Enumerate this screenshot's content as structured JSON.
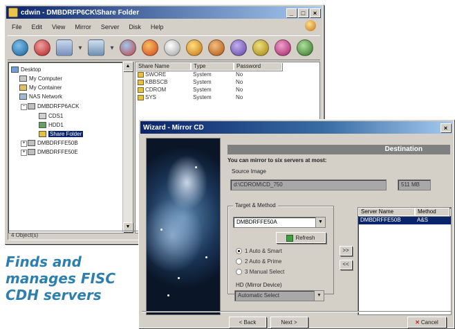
{
  "explorer": {
    "title": "cdwin - DMBDRFP6CK\\Share Folder",
    "menu": [
      "File",
      "Edit",
      "View",
      "Mirror",
      "Server",
      "Disk",
      "Help"
    ],
    "status": "4 Object(s)",
    "tree": [
      {
        "label": "Desktop",
        "level": 0
      },
      {
        "label": "My Computer",
        "level": 1
      },
      {
        "label": "My Container",
        "level": 1
      },
      {
        "label": "NAS Network",
        "level": 1
      },
      {
        "label": "DMBDRFP6ACK",
        "level": 2
      },
      {
        "label": "CDS1",
        "level": 3
      },
      {
        "label": "HDD1",
        "level": 3
      },
      {
        "label": "Share Folder",
        "level": 3,
        "selected": true
      },
      {
        "label": "DMBDRFFE50B",
        "level": 2
      },
      {
        "label": "DMBDRFFE50E",
        "level": 2
      }
    ],
    "columns": [
      "Share Name",
      "Type",
      "Password"
    ],
    "rows": [
      [
        "SWORE",
        "System",
        "No"
      ],
      [
        "KBBSCB",
        "System",
        "No"
      ],
      [
        "CDROM",
        "System",
        "No"
      ],
      [
        "SYS",
        "System",
        "No"
      ]
    ]
  },
  "wizard": {
    "title": "Wizard - Mirror CD",
    "header": "Destination",
    "instruction": "You can mirror to six servers at most:",
    "source_label": "Source Image",
    "source_value": "d:\\CDROM\\CD_750",
    "size_value": "511 MB",
    "target_label": "Target & Method",
    "target_value": "DMBDRFFE50A",
    "refresh_label": "Refresh",
    "radios": [
      "1 Auto & Smart",
      "2 Auto & Prime",
      "3 Manual Select"
    ],
    "hd_label": "HD (Mirror Device)",
    "hd_value": "Automatic Select",
    "add_button": ">>",
    "remove_button": "<<",
    "list_columns": [
      "Server Name",
      "Method"
    ],
    "list_rows": [
      [
        "DMBDRFFE50B",
        "A&S"
      ]
    ],
    "back_label": "< Back",
    "next_label": "Next >",
    "cancel_label": "Cancel"
  },
  "caption": [
    "Finds and",
    "manages FISC",
    "CDH servers"
  ]
}
